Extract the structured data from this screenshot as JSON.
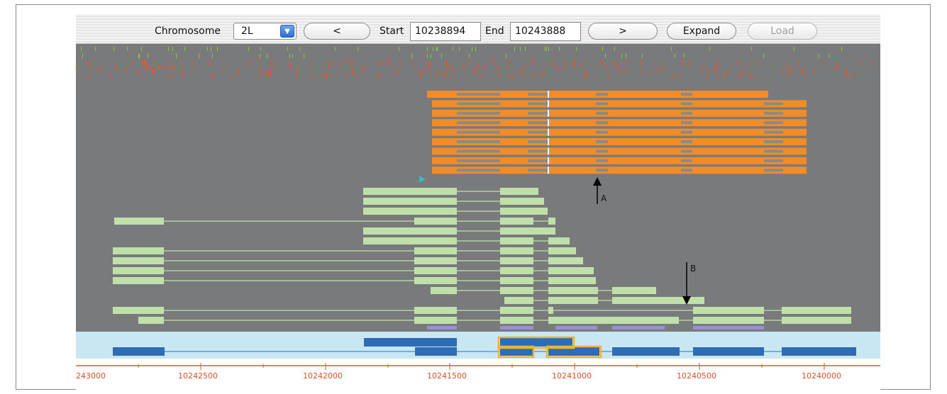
{
  "toolbar": {
    "chromosome_label": "Chromosome",
    "chromosome_value": "2L",
    "prev_label": "<",
    "start_label": "Start",
    "start_value": "10238894",
    "end_label": "End",
    "end_value": "10243888",
    "next_label": ">",
    "expand_label": "Expand",
    "load_label": "Load",
    "dropdown_icon": "chevron-down-icon"
  },
  "annotations": {
    "marker_a": "A",
    "marker_b": "B",
    "start_marker_icon": "triangle-right-icon"
  },
  "axis": {
    "ticks": [
      "243000",
      "10242500",
      "10242000",
      "10241500",
      "10241000",
      "10240500",
      "10240000"
    ]
  },
  "colors": {
    "track_background": "#787a7c",
    "orange_reads": "#f28c28",
    "green_transcripts": "#bfe0a8",
    "gene_model": "#2e6db4",
    "gene_panel": "#c9e6f3",
    "highlight": "#f2b233",
    "axis": "#e05a2b",
    "mismatch_red": "#e05a2b",
    "mismatch_green": "#8dc63f",
    "coverage": "#9a8fd3"
  }
}
